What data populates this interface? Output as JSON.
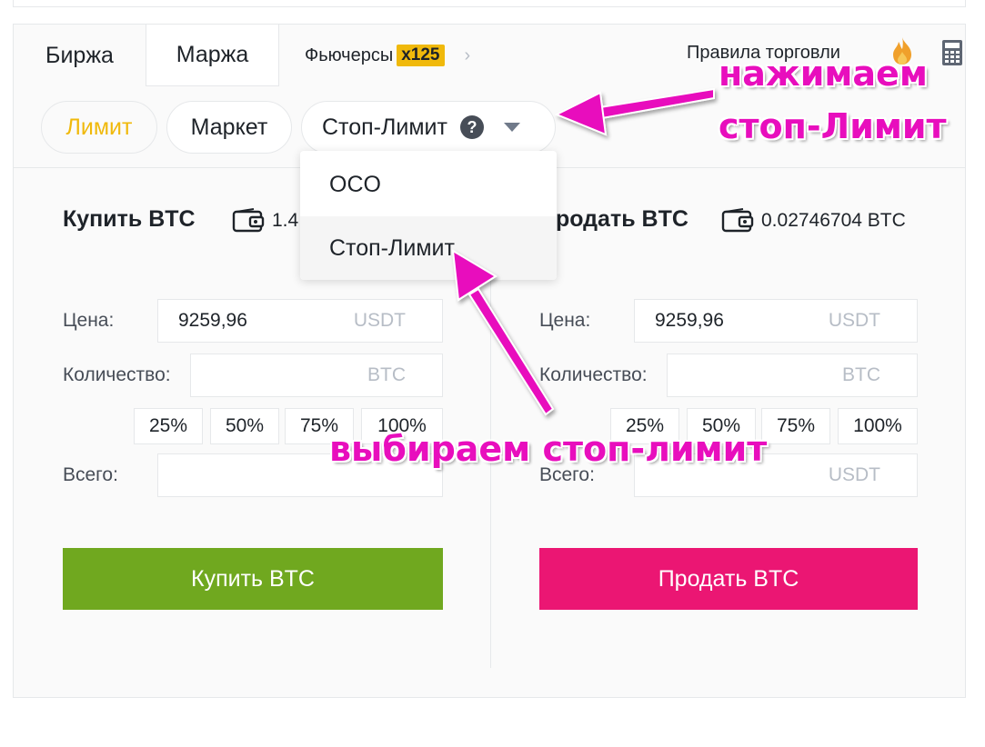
{
  "tabs": {
    "exchange": "Биржа",
    "margin": "Маржа",
    "futures": "Фьючерсы",
    "futures_badge": "x125",
    "rules": "Правила торговли"
  },
  "order_types": {
    "limit": "Лимит",
    "market": "Маркет",
    "stop_limit": "Стоп-Лимит",
    "help": "?"
  },
  "dropdown": {
    "items": [
      "OCO",
      "Стоп-Лимит"
    ]
  },
  "buy": {
    "title": "Купить BTC",
    "balance": "1.4",
    "price_label": "Цена:",
    "price_value": "9259,96",
    "price_unit": "USDT",
    "qty_label": "Количество:",
    "qty_unit": "BTC",
    "percents": [
      "25%",
      "50%",
      "75%",
      "100%"
    ],
    "total_label": "Всего:",
    "button": "Купить BTC"
  },
  "sell": {
    "title": "Продать BTC",
    "balance": "0.02746704 BTC",
    "price_label": "Цена:",
    "price_value": "9259,96",
    "price_unit": "USDT",
    "qty_label": "Количество:",
    "qty_unit": "BTC",
    "percents": [
      "25%",
      "50%",
      "75%",
      "100%"
    ],
    "total_label": "Всего:",
    "total_unit": "USDT",
    "button": "Продать BTC"
  },
  "annotations": {
    "click_line1": "нажимаем",
    "click_line2": "стоп-Лимит",
    "choose": "выбираем стоп-лимит"
  },
  "colors": {
    "accent_yellow": "#f0b90b",
    "buy_green": "#70a81f",
    "sell_pink": "#eb1673",
    "annotation_magenta": "#e80ebd"
  }
}
